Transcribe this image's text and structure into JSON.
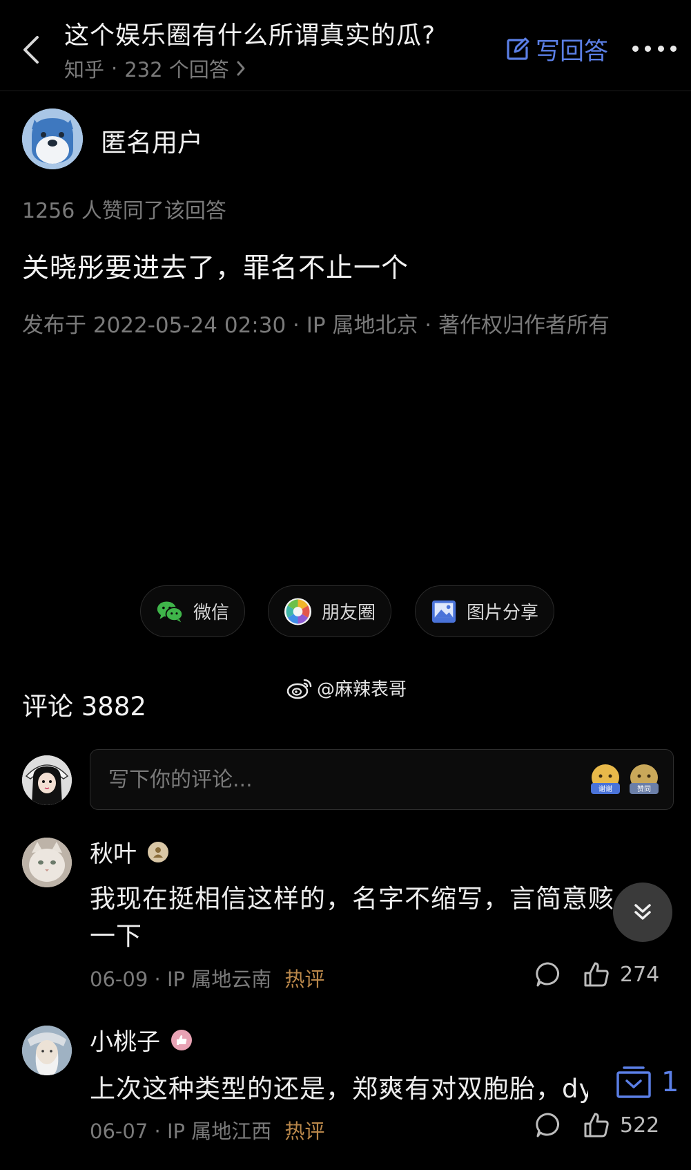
{
  "header": {
    "question_title": "这个娱乐圈有什么所谓真实的瓜?",
    "source": "知乎",
    "answers_count": "232 个回答",
    "write_answer_label": "写回答"
  },
  "answer": {
    "author_name": "匿名用户",
    "upvote_text": "1256 人赞同了该回答",
    "body": "关晓彤要进去了，罪名不止一个",
    "meta": "发布于 2022-05-24 02:30 · IP 属地北京 · 著作权归作者所有"
  },
  "share": {
    "wechat": "微信",
    "moments": "朋友圈",
    "image_share": "图片分享"
  },
  "watermark": "@麻辣表哥",
  "comments_section": {
    "heading": "评论 3882",
    "input_placeholder": "写下你的评论...",
    "sticker_labels": [
      "谢谢",
      "赞同"
    ]
  },
  "comments": [
    {
      "name": "秋叶",
      "text_line1": "我现在挺相信这样的，名字不缩写，言简意赅，",
      "text_line2": "一下",
      "date": "06-09",
      "location": "IP 属地云南",
      "tag": "热评",
      "likes": "274"
    },
    {
      "name": "小桃子",
      "text_line1": "上次这种类型的还是，郑爽有对双胞胎，dy",
      "date": "06-07",
      "location": "IP 属地江西",
      "tag": "热评",
      "likes": "522"
    }
  ],
  "collect_count": "1",
  "icons": {
    "back": "chevron-left-icon",
    "write": "edit-icon",
    "more": "more-dots-icon",
    "wechat": "wechat-icon",
    "moments": "moments-icon",
    "image": "image-icon",
    "weibo": "weibo-icon",
    "comment": "comment-bubble-icon",
    "like": "thumbs-up-icon",
    "scroll": "double-chevron-down-icon",
    "collect": "collect-icon"
  },
  "colors": {
    "background": "#000000",
    "accent": "#5b7fe6",
    "muted": "#7a7a7a",
    "hot": "#b9874a"
  }
}
